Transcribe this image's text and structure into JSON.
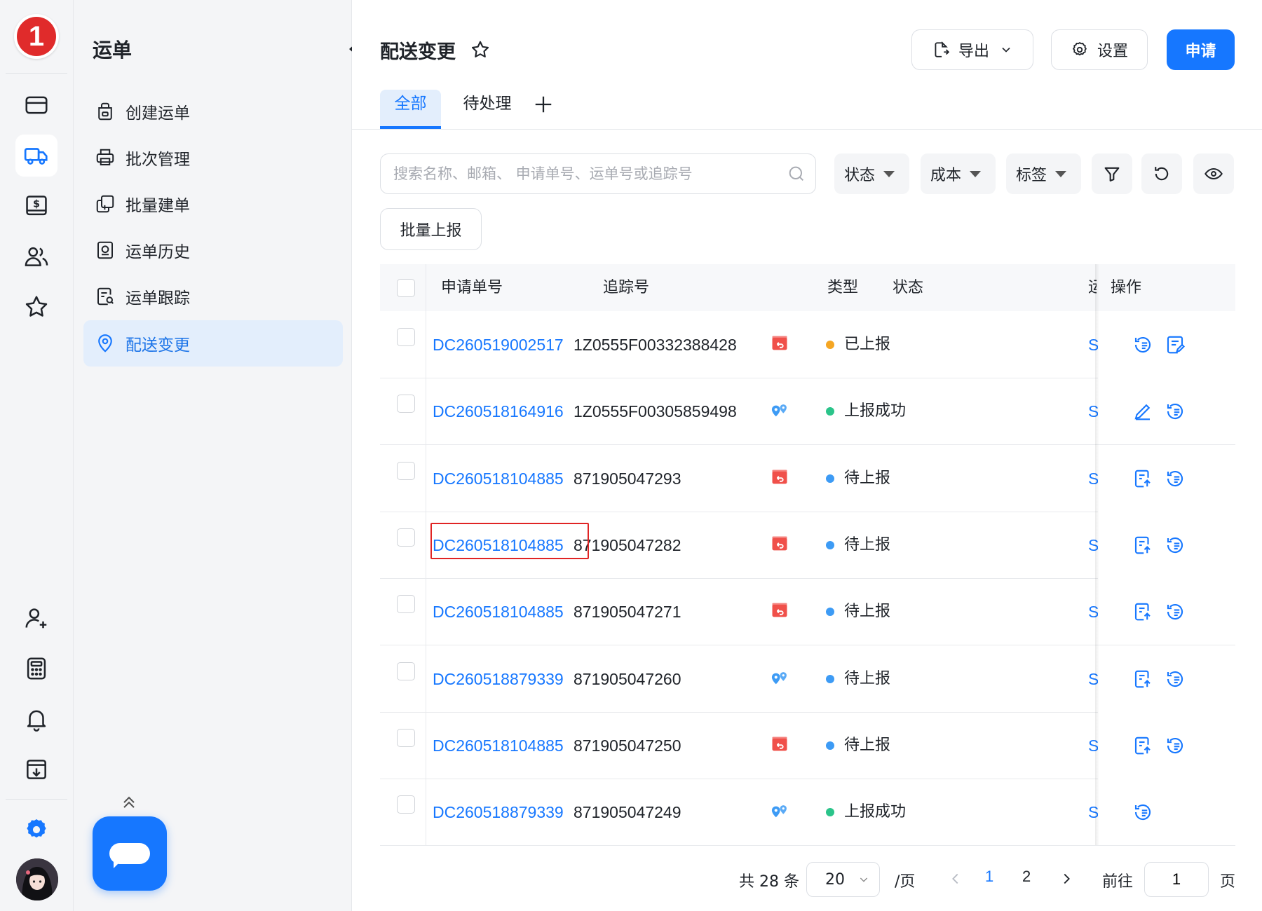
{
  "logo": {
    "badge": "1"
  },
  "rail": {
    "items": [
      {
        "icon": "card-icon",
        "active": false
      },
      {
        "icon": "truck-icon",
        "active": true
      },
      {
        "icon": "dollar-bill-icon",
        "active": false
      },
      {
        "icon": "users-icon",
        "active": false
      },
      {
        "icon": "star-icon",
        "active": false
      }
    ],
    "bottom_items": [
      {
        "icon": "user-add-icon"
      },
      {
        "icon": "calculator-icon"
      },
      {
        "icon": "bell-icon"
      },
      {
        "icon": "download-box-icon"
      },
      {
        "icon": "gear-icon"
      }
    ]
  },
  "sidebar": {
    "title": "运单",
    "items": [
      {
        "label": "创建运单",
        "icon": "create-order-icon",
        "active": false
      },
      {
        "label": "批次管理",
        "icon": "printer-icon",
        "active": false
      },
      {
        "label": "批量建单",
        "icon": "batch-create-icon",
        "active": false
      },
      {
        "label": "运单历史",
        "icon": "history-icon",
        "active": false
      },
      {
        "label": "运单跟踪",
        "icon": "tracking-icon",
        "active": false
      },
      {
        "label": "配送变更",
        "icon": "location-icon",
        "active": true
      }
    ]
  },
  "header": {
    "title": "配送变更",
    "export_label": "导出",
    "settings_label": "设置",
    "apply_label": "申请"
  },
  "tabs": [
    {
      "label": "全部",
      "active": true
    },
    {
      "label": "待处理",
      "active": false
    }
  ],
  "search": {
    "placeholder": "搜索名称、邮箱、 申请单号、运单号或追踪号",
    "value": ""
  },
  "filters": {
    "status": "状态",
    "cost": "成本",
    "tag": "标签"
  },
  "bulk_report_label": "批量上报",
  "table": {
    "columns": {
      "request_no": "申请单号",
      "tracking_no": "追踪号",
      "type": "类型",
      "status": "状态",
      "truncated": "运",
      "ops": "操作"
    },
    "rows": [
      {
        "request_no": "DC260519002517",
        "tracking_no": "1Z0555F00332388428",
        "type": "return",
        "status": "已上报",
        "status_color": "#f5a623",
        "truncated": "S",
        "actions": [
          "history-icon",
          "note-edit-icon"
        ]
      },
      {
        "request_no": "DC260518164916",
        "tracking_no": "1Z0555F00305859498",
        "type": "redirect",
        "status": "上报成功",
        "status_color": "#2bc48a",
        "truncated": "S",
        "actions": [
          "pencil-icon",
          "history-icon"
        ]
      },
      {
        "request_no": "DC260518104885",
        "tracking_no": "871905047293",
        "type": "return",
        "status": "待上报",
        "status_color": "#3d9bf5",
        "truncated": "S",
        "actions": [
          "upload-report-icon",
          "history-icon"
        ]
      },
      {
        "request_no": "DC260518104885",
        "tracking_no": "871905047282",
        "type": "return",
        "status": "待上报",
        "status_color": "#3d9bf5",
        "truncated": "S",
        "actions": [
          "upload-report-icon",
          "history-icon"
        ]
      },
      {
        "request_no": "DC260518104885",
        "tracking_no": "871905047271",
        "type": "return",
        "status": "待上报",
        "status_color": "#3d9bf5",
        "truncated": "S",
        "actions": [
          "upload-report-icon",
          "history-icon"
        ]
      },
      {
        "request_no": "DC260518879339",
        "tracking_no": "871905047260",
        "type": "redirect",
        "status": "待上报",
        "status_color": "#3d9bf5",
        "truncated": "S",
        "actions": [
          "upload-report-icon",
          "history-icon"
        ]
      },
      {
        "request_no": "DC260518104885",
        "tracking_no": "871905047250",
        "type": "return",
        "status": "待上报",
        "status_color": "#3d9bf5",
        "truncated": "S",
        "actions": [
          "upload-report-icon",
          "history-icon"
        ]
      },
      {
        "request_no": "DC260518879339",
        "tracking_no": "871905047249",
        "type": "redirect",
        "status": "上报成功",
        "status_color": "#2bc48a",
        "truncated": "S",
        "actions": [
          "history-icon"
        ]
      }
    ]
  },
  "pagination": {
    "total_prefix": "共",
    "total": "28",
    "total_suffix": "条",
    "page_size": "20",
    "per_page": "/页",
    "pages": [
      "1",
      "2"
    ],
    "current_page": "1",
    "goto_label": "前往",
    "goto_value": "1",
    "page_suffix": "页"
  },
  "colors": {
    "accent": "#1677ff",
    "highlight": "#e02424",
    "return_icon": "#f0504a",
    "redirect_icon": "#3d9bf5"
  }
}
